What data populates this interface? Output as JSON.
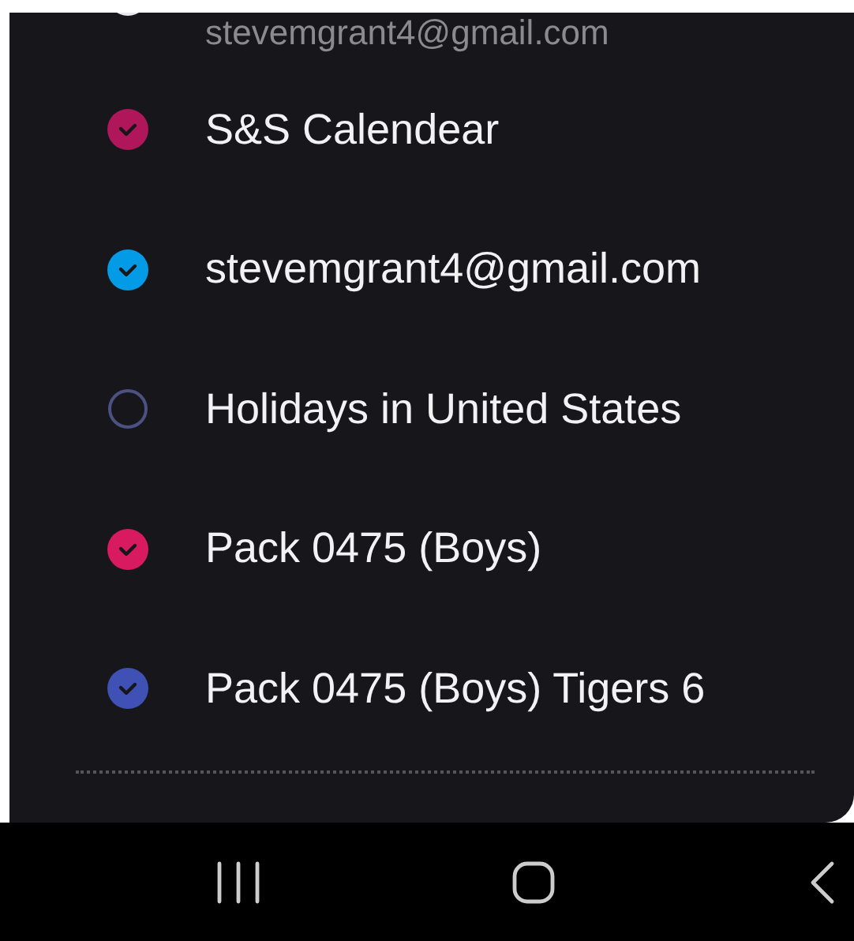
{
  "account_header": {
    "email": "stevemgrant4@gmail.com"
  },
  "calendars": [
    {
      "name": "S&S Calendear",
      "checked": true,
      "color": "#b0175a"
    },
    {
      "name": "stevemgrant4@gmail.com",
      "checked": true,
      "color": "#039be5"
    },
    {
      "name": "Holidays in United States",
      "checked": false,
      "color": "#4b5180"
    },
    {
      "name": "Pack 0475 (Boys)",
      "checked": true,
      "color": "#d81b60"
    },
    {
      "name": "Pack 0475 (Boys) Tigers 6",
      "checked": true,
      "color": "#3f51b5"
    }
  ]
}
